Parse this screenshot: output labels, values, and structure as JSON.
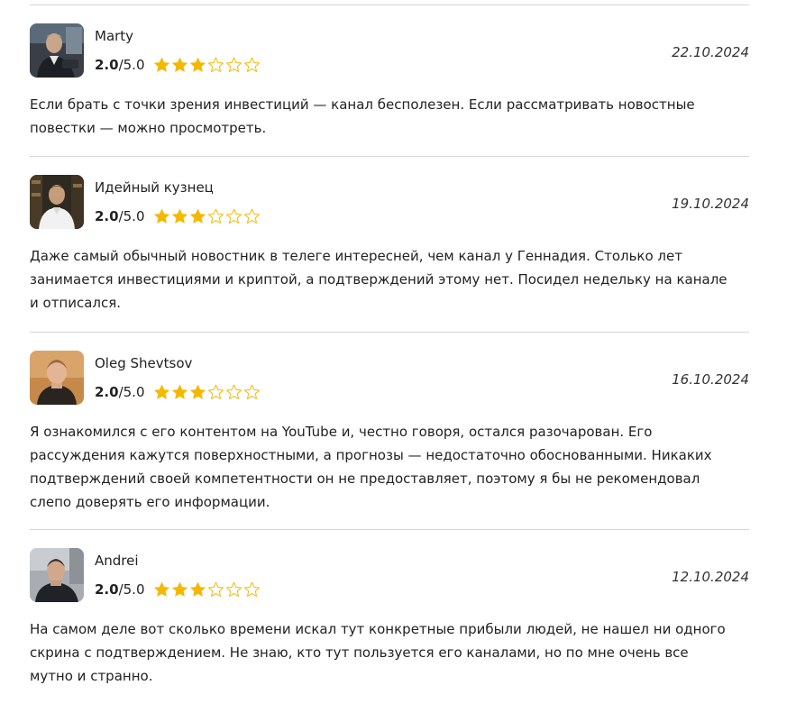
{
  "reviews": [
    {
      "author": "Marty",
      "score": "2.0",
      "max_score": "/5.0",
      "stars_filled": 3,
      "stars_total": 6,
      "date": "22.10.2024",
      "text": "Если брать с точки зрения инвестиций — канал бесполезен. Если рассматривать новостные повестки — можно просмотреть."
    },
    {
      "author": "Идейный кузнец",
      "score": "2.0",
      "max_score": "/5.0",
      "stars_filled": 3,
      "stars_total": 6,
      "date": "19.10.2024",
      "text": "Даже самый обычный новостник в телеге интересней, чем канал у Геннадия. Столько лет занимается инвестициями и криптой, а подтверждений этому нет. Посидел недельку на канале и отписался."
    },
    {
      "author": "Oleg Shevtsov",
      "score": "2.0",
      "max_score": "/5.0",
      "stars_filled": 3,
      "stars_total": 6,
      "date": "16.10.2024",
      "text": "Я ознакомился с его контентом на YouTube и, честно говоря, остался разочарован. Его рассуждения кажутся поверхностными, а прогнозы — недостаточно обоснованными. Никаких подтверждений своей компетентности он не предоставляет, поэтому я бы не рекомендовал слепо доверять его информации."
    },
    {
      "author": "Andrei",
      "score": "2.0",
      "max_score": "/5.0",
      "stars_filled": 3,
      "stars_total": 6,
      "date": "12.10.2024",
      "text": "На самом деле вот сколько времени искал тут конкретные прибыли людей, не нашел ни одного скрина с подтверждением. Не знаю, кто тут пользуется его каналами, но по мне очень все мутно и странно."
    }
  ],
  "colors": {
    "star": "#f5b800",
    "divider": "#d6d6d6",
    "text": "#222222"
  },
  "icons": {
    "star_filled": "star-filled-icon",
    "star_empty": "star-outline-icon"
  }
}
